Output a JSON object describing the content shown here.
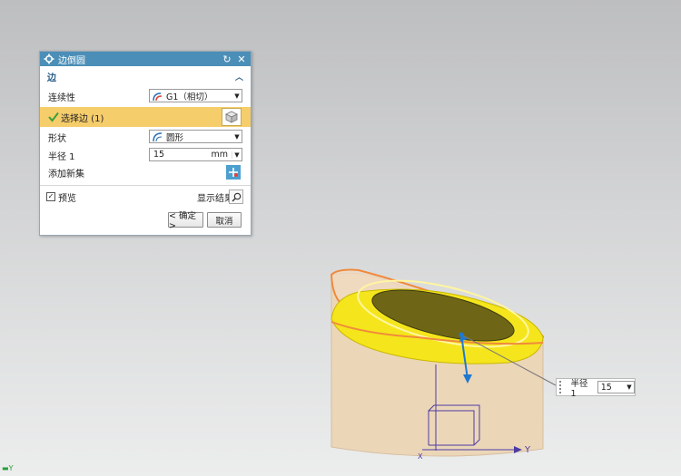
{
  "dialog": {
    "title": "边倒圆",
    "section_title": "边",
    "continuity": {
      "label": "连续性",
      "value": "G1（相切）"
    },
    "select_edge": {
      "label": "选择边 (1)"
    },
    "shape": {
      "label": "形状",
      "value": "圆形"
    },
    "radius": {
      "label": "半径 1",
      "value": "15",
      "unit": "mm"
    },
    "add_new_set": {
      "label": "添加新集"
    },
    "preview": {
      "label": "预览",
      "checked": true
    },
    "show_result": {
      "label": "显示结果"
    },
    "ok_button": "< 确定 >",
    "cancel_button": "取消"
  },
  "viewport": {
    "radius_popup": {
      "label": "半径 1",
      "value": "15"
    },
    "axis_label_y": "Y",
    "axis_label_x": "X",
    "corner_axis": "Y"
  },
  "colors": {
    "titlebar": "#4b8fb8",
    "selected_row": "#f6cd6b",
    "fillet_yellow": "#f5e51c",
    "cylinder_body": "#ecd6b8",
    "edge_highlight": "#f08a3c"
  },
  "icons": [
    "gear-icon",
    "reset-icon",
    "close-icon",
    "chevron-up-icon",
    "continuity-icon",
    "check-icon",
    "cube-icon",
    "shape-icon",
    "add-set-icon",
    "magnifier-icon"
  ]
}
